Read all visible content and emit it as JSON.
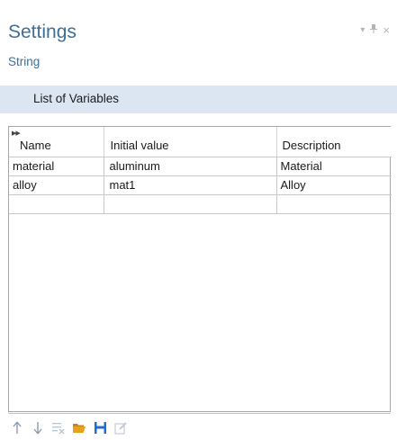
{
  "header": {
    "title": "Settings",
    "subtitle": "String",
    "window_controls": [
      "chevron-down-icon",
      "pin-icon",
      "close-icon"
    ]
  },
  "section": {
    "label": "List of Variables"
  },
  "table": {
    "columns": [
      "Name",
      "Initial value",
      "Description"
    ],
    "rows": [
      [
        "material",
        "aluminum",
        "Material"
      ],
      [
        "alloy",
        "mat1",
        "Alloy"
      ],
      [
        "",
        "",
        ""
      ]
    ]
  },
  "toolbar": {
    "icons": [
      "move-up-icon",
      "move-down-icon",
      "delete-icon",
      "open-folder-icon",
      "save-icon",
      "edit-icon"
    ]
  },
  "colors": {
    "title": "#3e6f96",
    "section_header_bg": "#dce6f2",
    "toolbar_blue": "#1f6fd0",
    "folder_orange": "#e8a21a"
  }
}
